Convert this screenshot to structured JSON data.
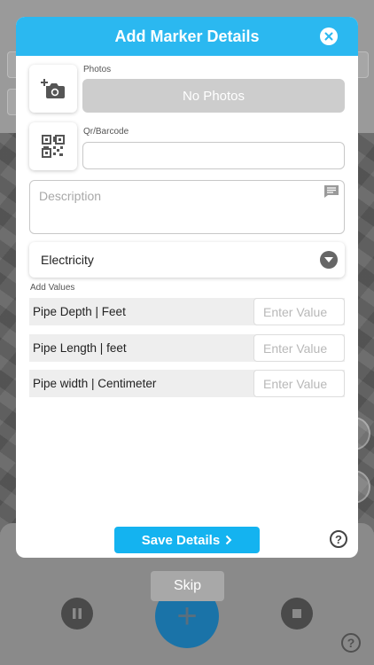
{
  "modal": {
    "title": "Add Marker Details",
    "photos_label": "Photos",
    "no_photos_text": "No Photos",
    "qr_label": "Qr/Barcode",
    "qr_value": "",
    "description_placeholder": "Description",
    "category_selected": "Electricity",
    "add_values_label": "Add Values",
    "value_rows": [
      {
        "label": "Pipe Depth | Feet",
        "placeholder": "Enter Value"
      },
      {
        "label": "Pipe Length | feet",
        "placeholder": "Enter Value"
      },
      {
        "label": "Pipe width | Centimeter",
        "placeholder": "Enter Value"
      }
    ],
    "save_label": "Save Details",
    "help_symbol": "?"
  },
  "background": {
    "skip_label": "Skip",
    "add_symbol": "+",
    "help_symbol": "?"
  },
  "colors": {
    "header": "#2bb8f0",
    "save_button": "#14b3f0",
    "no_photos_bg": "#cdcdcd"
  },
  "icons": {
    "add_photo": "camera-plus-icon",
    "qr_code": "qr-code-icon",
    "close": "close-icon",
    "comment": "comment-icon",
    "dropdown": "chevron-down-icon",
    "save_arrow": "chevron-right-icon",
    "help": "help-icon"
  }
}
